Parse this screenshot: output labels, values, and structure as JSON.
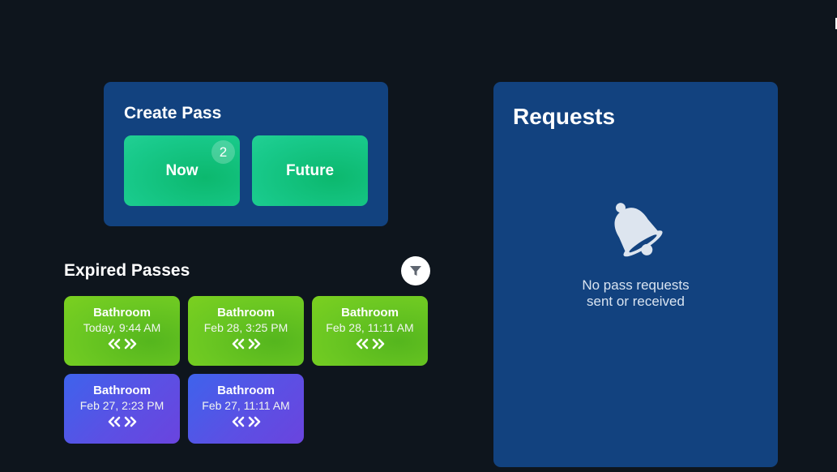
{
  "create_pass": {
    "title": "Create Pass",
    "now_label": "Now",
    "now_badge": "2",
    "future_label": "Future"
  },
  "expired_passes": {
    "title": "Expired Passes",
    "filter_icon": "filter-icon",
    "passes": [
      {
        "name": "Bathroom",
        "time": "Today, 9:44 AM",
        "color": "#6cc822"
      },
      {
        "name": "Bathroom",
        "time": "Feb 28, 3:25 PM",
        "color": "#6cc822"
      },
      {
        "name": "Bathroom",
        "time": "Feb 28, 11:11 AM",
        "color": "#6cc822"
      },
      {
        "name": "Bathroom",
        "time": "Feb 27, 2:23 PM",
        "color": "#5b50e4"
      },
      {
        "name": "Bathroom",
        "time": "Feb 27, 11:11 AM",
        "color": "#5b50e4"
      }
    ]
  },
  "requests": {
    "title": "Requests",
    "empty_icon": "bell-icon",
    "empty_line1": "No pass requests",
    "empty_line2": "sent or received"
  },
  "colors": {
    "background": "#0e151d",
    "card": "#12427f",
    "create_button": "#18c98a",
    "pass_green": "#6cc822",
    "pass_purple": "#5b50e4"
  }
}
